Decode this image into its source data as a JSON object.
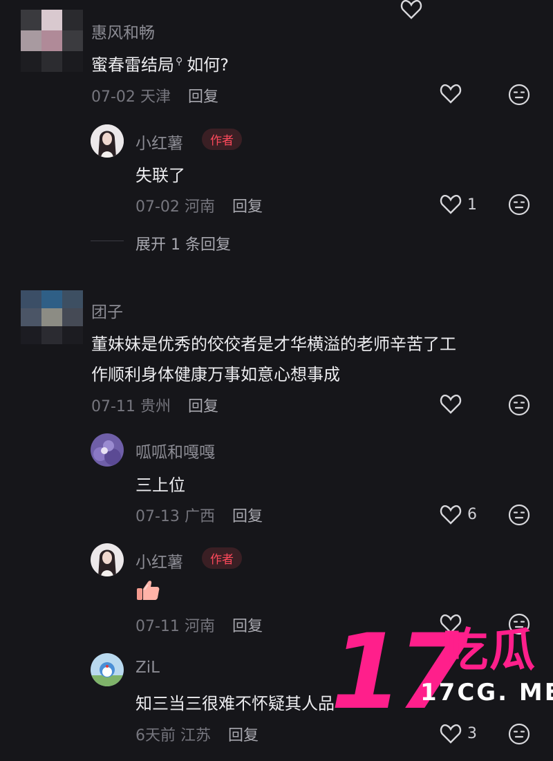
{
  "comments": [
    {
      "user": "惠风和畅",
      "text": "蜜春雷结局",
      "text_suffix": "如何?",
      "date": "07-02",
      "location": "天津",
      "reply_label": "回复",
      "replies": [
        {
          "user": "小红薯",
          "badge": "作者",
          "text": "失联了",
          "date": "07-02",
          "location": "河南",
          "reply_label": "回复",
          "likes": "1"
        }
      ],
      "expand_label": "展开 1 条回复"
    },
    {
      "user": "团子",
      "text_line1": "董妹妹是优秀的佼佼者是才华横溢的老师辛苦了工",
      "text_line2": "作顺利身体健康万事如意心想事成",
      "date": "07-11",
      "location": "贵州",
      "reply_label": "回复",
      "replies": [
        {
          "user": "呱呱和嘎嘎",
          "text": "三上位",
          "date": "07-13",
          "location": "广西",
          "reply_label": "回复",
          "likes": "6"
        },
        {
          "user": "小红薯",
          "badge": "作者",
          "text_emoji": "thumbs-up",
          "date": "07-11",
          "location": "河南",
          "reply_label": "回复"
        },
        {
          "user": "ZiL",
          "text": "知三当三很难不怀疑其人品",
          "date": "6天前",
          "location": "江苏",
          "reply_label": "回复",
          "likes": "3"
        }
      ]
    }
  ],
  "watermark": {
    "number": "17",
    "chinese": "吃瓜",
    "url": "17CG. ME"
  },
  "colors": {
    "background": "#16161a",
    "author_badge": "#ff4a5c",
    "watermark": "#ff1f8b"
  }
}
